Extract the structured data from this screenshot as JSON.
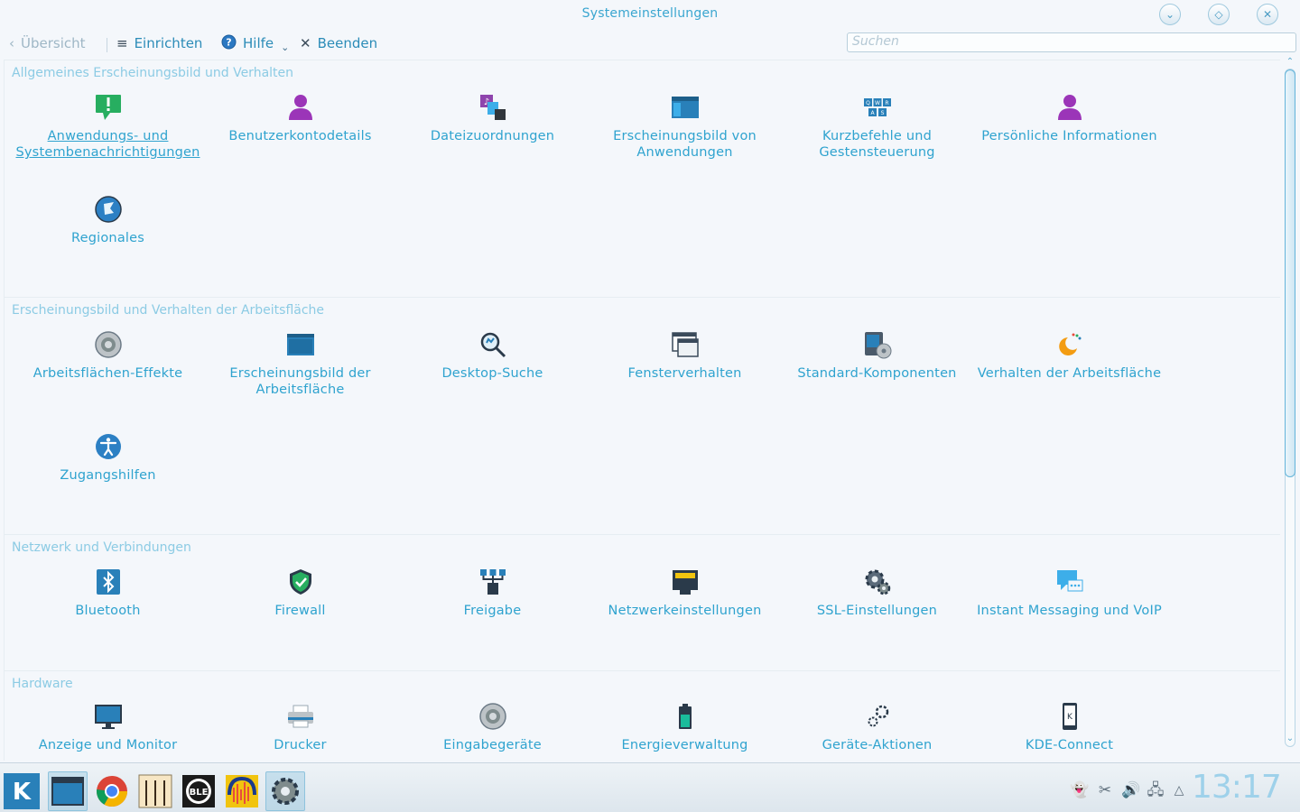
{
  "window": {
    "title": "Systemeinstellungen"
  },
  "toolbar": {
    "back_label": "Übersicht",
    "configure_label": "Einrichten",
    "help_label": "Hilfe",
    "quit_label": "Beenden",
    "search_placeholder": "Suchen"
  },
  "categories": [
    {
      "title": "Allgemeines Erscheinungsbild und Verhalten",
      "items": [
        {
          "label": "Anwendungs- und Systembenachrichtigungen",
          "icon": "notifications-icon"
        },
        {
          "label": "Benutzerkontodetails",
          "icon": "user-account-icon"
        },
        {
          "label": "Dateizuordnungen",
          "icon": "file-associations-icon"
        },
        {
          "label": "Erscheinungsbild von Anwendungen",
          "icon": "application-appearance-icon"
        },
        {
          "label": "Kurzbefehle und Gestensteuerung",
          "icon": "keyboard-shortcuts-icon"
        },
        {
          "label": "Persönliche Informationen",
          "icon": "personal-info-icon"
        },
        {
          "label": "Regionales",
          "icon": "regional-icon"
        }
      ]
    },
    {
      "title": "Erscheinungsbild und Verhalten der Arbeitsfläche",
      "items": [
        {
          "label": "Arbeitsflächen-Effekte",
          "icon": "desktop-effects-icon"
        },
        {
          "label": "Erscheinungsbild der Arbeitsfläche",
          "icon": "workspace-appearance-icon"
        },
        {
          "label": "Desktop-Suche",
          "icon": "desktop-search-icon"
        },
        {
          "label": "Fensterverhalten",
          "icon": "window-behavior-icon"
        },
        {
          "label": "Standard-Komponenten",
          "icon": "default-components-icon"
        },
        {
          "label": "Verhalten der Arbeitsfläche",
          "icon": "workspace-behavior-icon"
        },
        {
          "label": "Zugangshilfen",
          "icon": "accessibility-icon"
        }
      ]
    },
    {
      "title": "Netzwerk und Verbindungen",
      "items": [
        {
          "label": "Bluetooth",
          "icon": "bluetooth-icon"
        },
        {
          "label": "Firewall",
          "icon": "firewall-icon"
        },
        {
          "label": "Freigabe",
          "icon": "sharing-icon"
        },
        {
          "label": "Netzwerkeinstellungen",
          "icon": "network-settings-icon"
        },
        {
          "label": "SSL-Einstellungen",
          "icon": "ssl-settings-icon"
        },
        {
          "label": "Instant Messaging und VoIP",
          "icon": "instant-messaging-icon"
        }
      ]
    },
    {
      "title": "Hardware",
      "items": [
        {
          "label": "Anzeige und Monitor",
          "icon": "display-monitor-icon"
        },
        {
          "label": "Drucker",
          "icon": "printer-icon"
        },
        {
          "label": "Eingabegeräte",
          "icon": "input-devices-icon"
        },
        {
          "label": "Energieverwaltung",
          "icon": "power-management-icon"
        },
        {
          "label": "Geräte-Aktionen",
          "icon": "device-actions-icon"
        },
        {
          "label": "KDE-Connect",
          "icon": "kde-connect-icon"
        }
      ]
    }
  ],
  "taskbar": {
    "apps": [
      "kde-menu-icon",
      "file-manager-icon",
      "chrome-icon",
      "notes-icon",
      "ble-icon",
      "audacity-icon",
      "system-settings-icon"
    ],
    "tray": [
      "ghost-icon",
      "scissors-icon",
      "volume-icon",
      "network-icon",
      "expand-icon"
    ],
    "clock": "13:17"
  }
}
